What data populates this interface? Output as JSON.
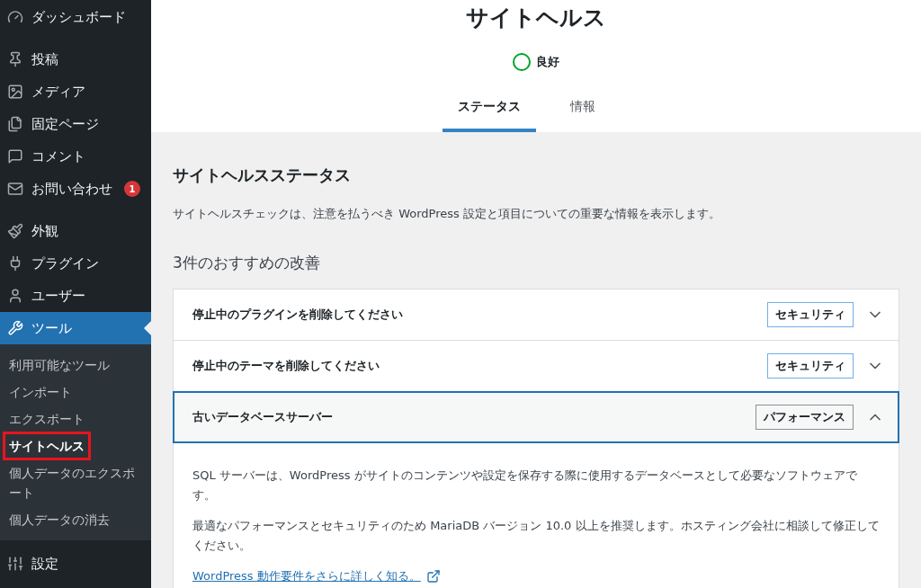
{
  "sidebar": {
    "groups": [
      {
        "items": [
          {
            "label": "ダッシュボード",
            "selected": false
          }
        ]
      },
      {
        "items": [
          {
            "label": "投稿",
            "selected": false
          },
          {
            "label": "メディア",
            "selected": false
          },
          {
            "label": "固定ページ",
            "selected": false
          },
          {
            "label": "コメント",
            "selected": false
          },
          {
            "label": "お問い合わせ",
            "selected": false,
            "badge": "1"
          }
        ]
      },
      {
        "items": [
          {
            "label": "外観",
            "selected": false
          },
          {
            "label": "プラグイン",
            "selected": false
          },
          {
            "label": "ユーザー",
            "selected": false
          },
          {
            "label": "ツール",
            "selected": true,
            "children": [
              {
                "label": "利用可能なツール",
                "selected": false,
                "highlighted": false
              },
              {
                "label": "インポート",
                "selected": false,
                "highlighted": false
              },
              {
                "label": "エクスポート",
                "selected": false,
                "highlighted": false
              },
              {
                "label": "サイトヘルス",
                "selected": true,
                "highlighted": true
              },
              {
                "label": "個人データのエクスポート",
                "selected": false,
                "highlighted": false
              },
              {
                "label": "個人データの消去",
                "selected": false,
                "highlighted": false
              }
            ]
          },
          {
            "label": "設定",
            "selected": false
          }
        ]
      }
    ]
  },
  "header": {
    "title": "サイトヘルス",
    "status": "良好",
    "tabs": [
      {
        "label": "ステータス",
        "selected": true
      },
      {
        "label": "情報",
        "selected": false
      }
    ]
  },
  "content": {
    "heading": "サイトヘルスステータス",
    "description": "サイトヘルスチェックは、注意を払うべき WordPress 設定と項目についての重要な情報を表示します。",
    "subheading": "3件のおすすめの改善",
    "issues": [
      {
        "title": "停止中のプラグインを削除してください",
        "badge": "セキュリティ",
        "color": "#72aee6",
        "expanded": false
      },
      {
        "title": "停止中のテーマを削除してください",
        "badge": "セキュリティ",
        "color": "#72aee6",
        "expanded": false
      },
      {
        "title": "古いデータベースサーバー",
        "badge": "パフォーマンス",
        "color": "#8c8f94",
        "expanded": true,
        "paragraphs": [
          "SQL サーバーは、WordPress がサイトのコンテンツや設定を保存する際に使用するデータベースとして必要なソフトウェアです。",
          "最適なパフォーマンスとセキュリティのため MariaDB バージョン 10.0 以上を推奨します。ホスティング会社に相談して修正してください。"
        ],
        "link": "WordPress 動作要件をさらに詳しく知る。"
      }
    ]
  }
}
